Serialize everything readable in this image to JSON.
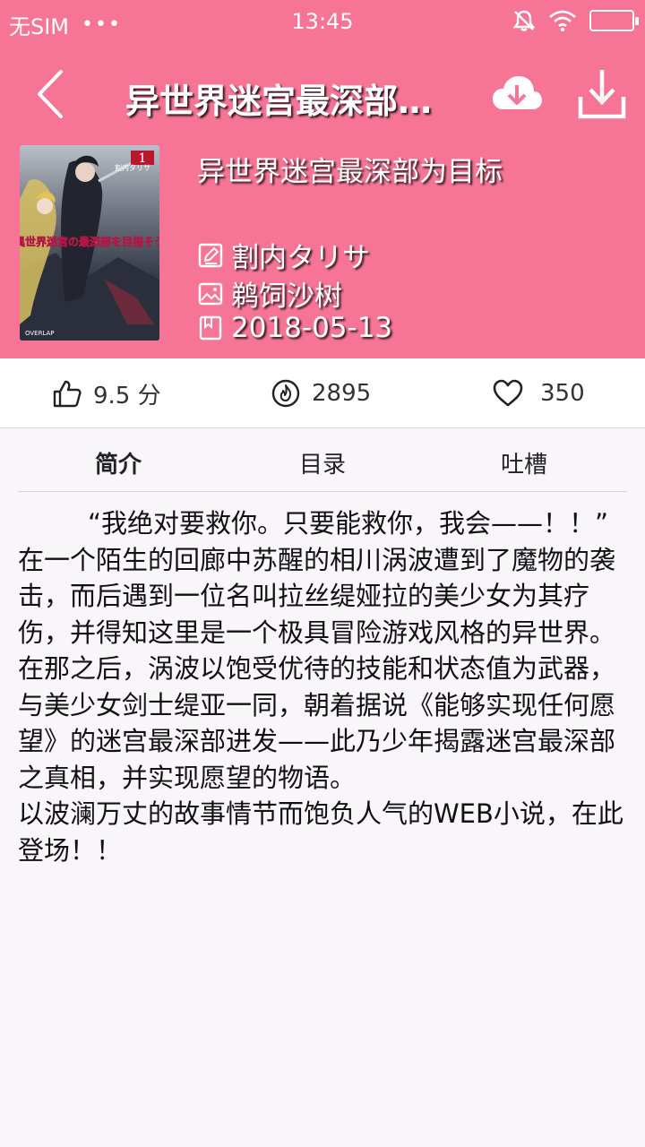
{
  "statusbar": {
    "carrier": "无SIM",
    "dots": "•••",
    "time": "13:45"
  },
  "navbar": {
    "title": "异世界迷宫最深部…"
  },
  "book": {
    "title": "异世界迷宫最深部为目标",
    "author": "割内タリサ",
    "illustrator": "鹈饲沙树",
    "date": "2018-05-13",
    "cover": {
      "volume": "1",
      "cover_title": "異世界迷宮の最深部を目指そう",
      "author_credit": "割内タリサ",
      "publisher": "OVERLAP"
    }
  },
  "stats": {
    "rating": "9.5 分",
    "heat": "2895",
    "favorites": "350"
  },
  "tabs": [
    "简介",
    "目录",
    "吐槽"
  ],
  "description": [
    "“我绝对要救你。只要能救你，我会——！！”",
    "在一个陌生的回廊中苏醒的相川涡波遭到了魔物的袭击，而后遇到一位名叫拉丝缇娅拉的美少女为其疗伤，并得知这里是一个极具冒险游戏风格的异世界。在那之后，涡波以饱受优待的技能和状态值为武器，与美少女剑士缇亚一同，朝着据说《能够实现任何愿望》的迷宫最深部进发——此乃少年揭露迷宫最深部之真相，并实现愿望的物语。",
    "以波澜万丈的故事情节而饱负人气的WEB小说，在此登场！！"
  ],
  "colors": {
    "header": "#f67596",
    "background": "#f8f6f9"
  },
  "icons": {
    "statusbar": [
      "mute-icon",
      "wifi-icon",
      "battery-icon"
    ],
    "nav": [
      "back-icon",
      "cloud-download-icon",
      "download-icon"
    ],
    "meta": [
      "pencil-icon",
      "image-icon",
      "book-icon"
    ],
    "stats": [
      "thumbs-up-icon",
      "fire-icon",
      "heart-icon"
    ]
  }
}
